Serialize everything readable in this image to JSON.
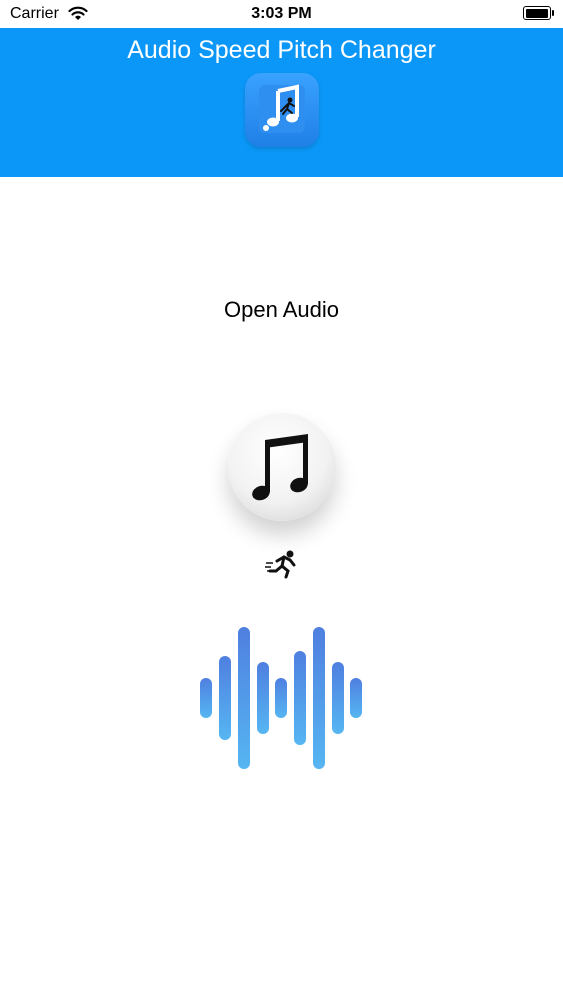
{
  "status_bar": {
    "carrier": "Carrier",
    "time": "3:03 PM",
    "wifi_icon": "wifi-icon",
    "battery_icon": "battery-icon"
  },
  "header": {
    "title": "Audio Speed Pitch Changer",
    "background_color": "#0b97f7",
    "app_icon": "music-note-runner-icon"
  },
  "main": {
    "open_audio_label": "Open Audio",
    "music_button_icon": "music-note-icon",
    "runner_icon": "running-person-icon",
    "waveform_icon": "audio-waveform-icon"
  }
}
